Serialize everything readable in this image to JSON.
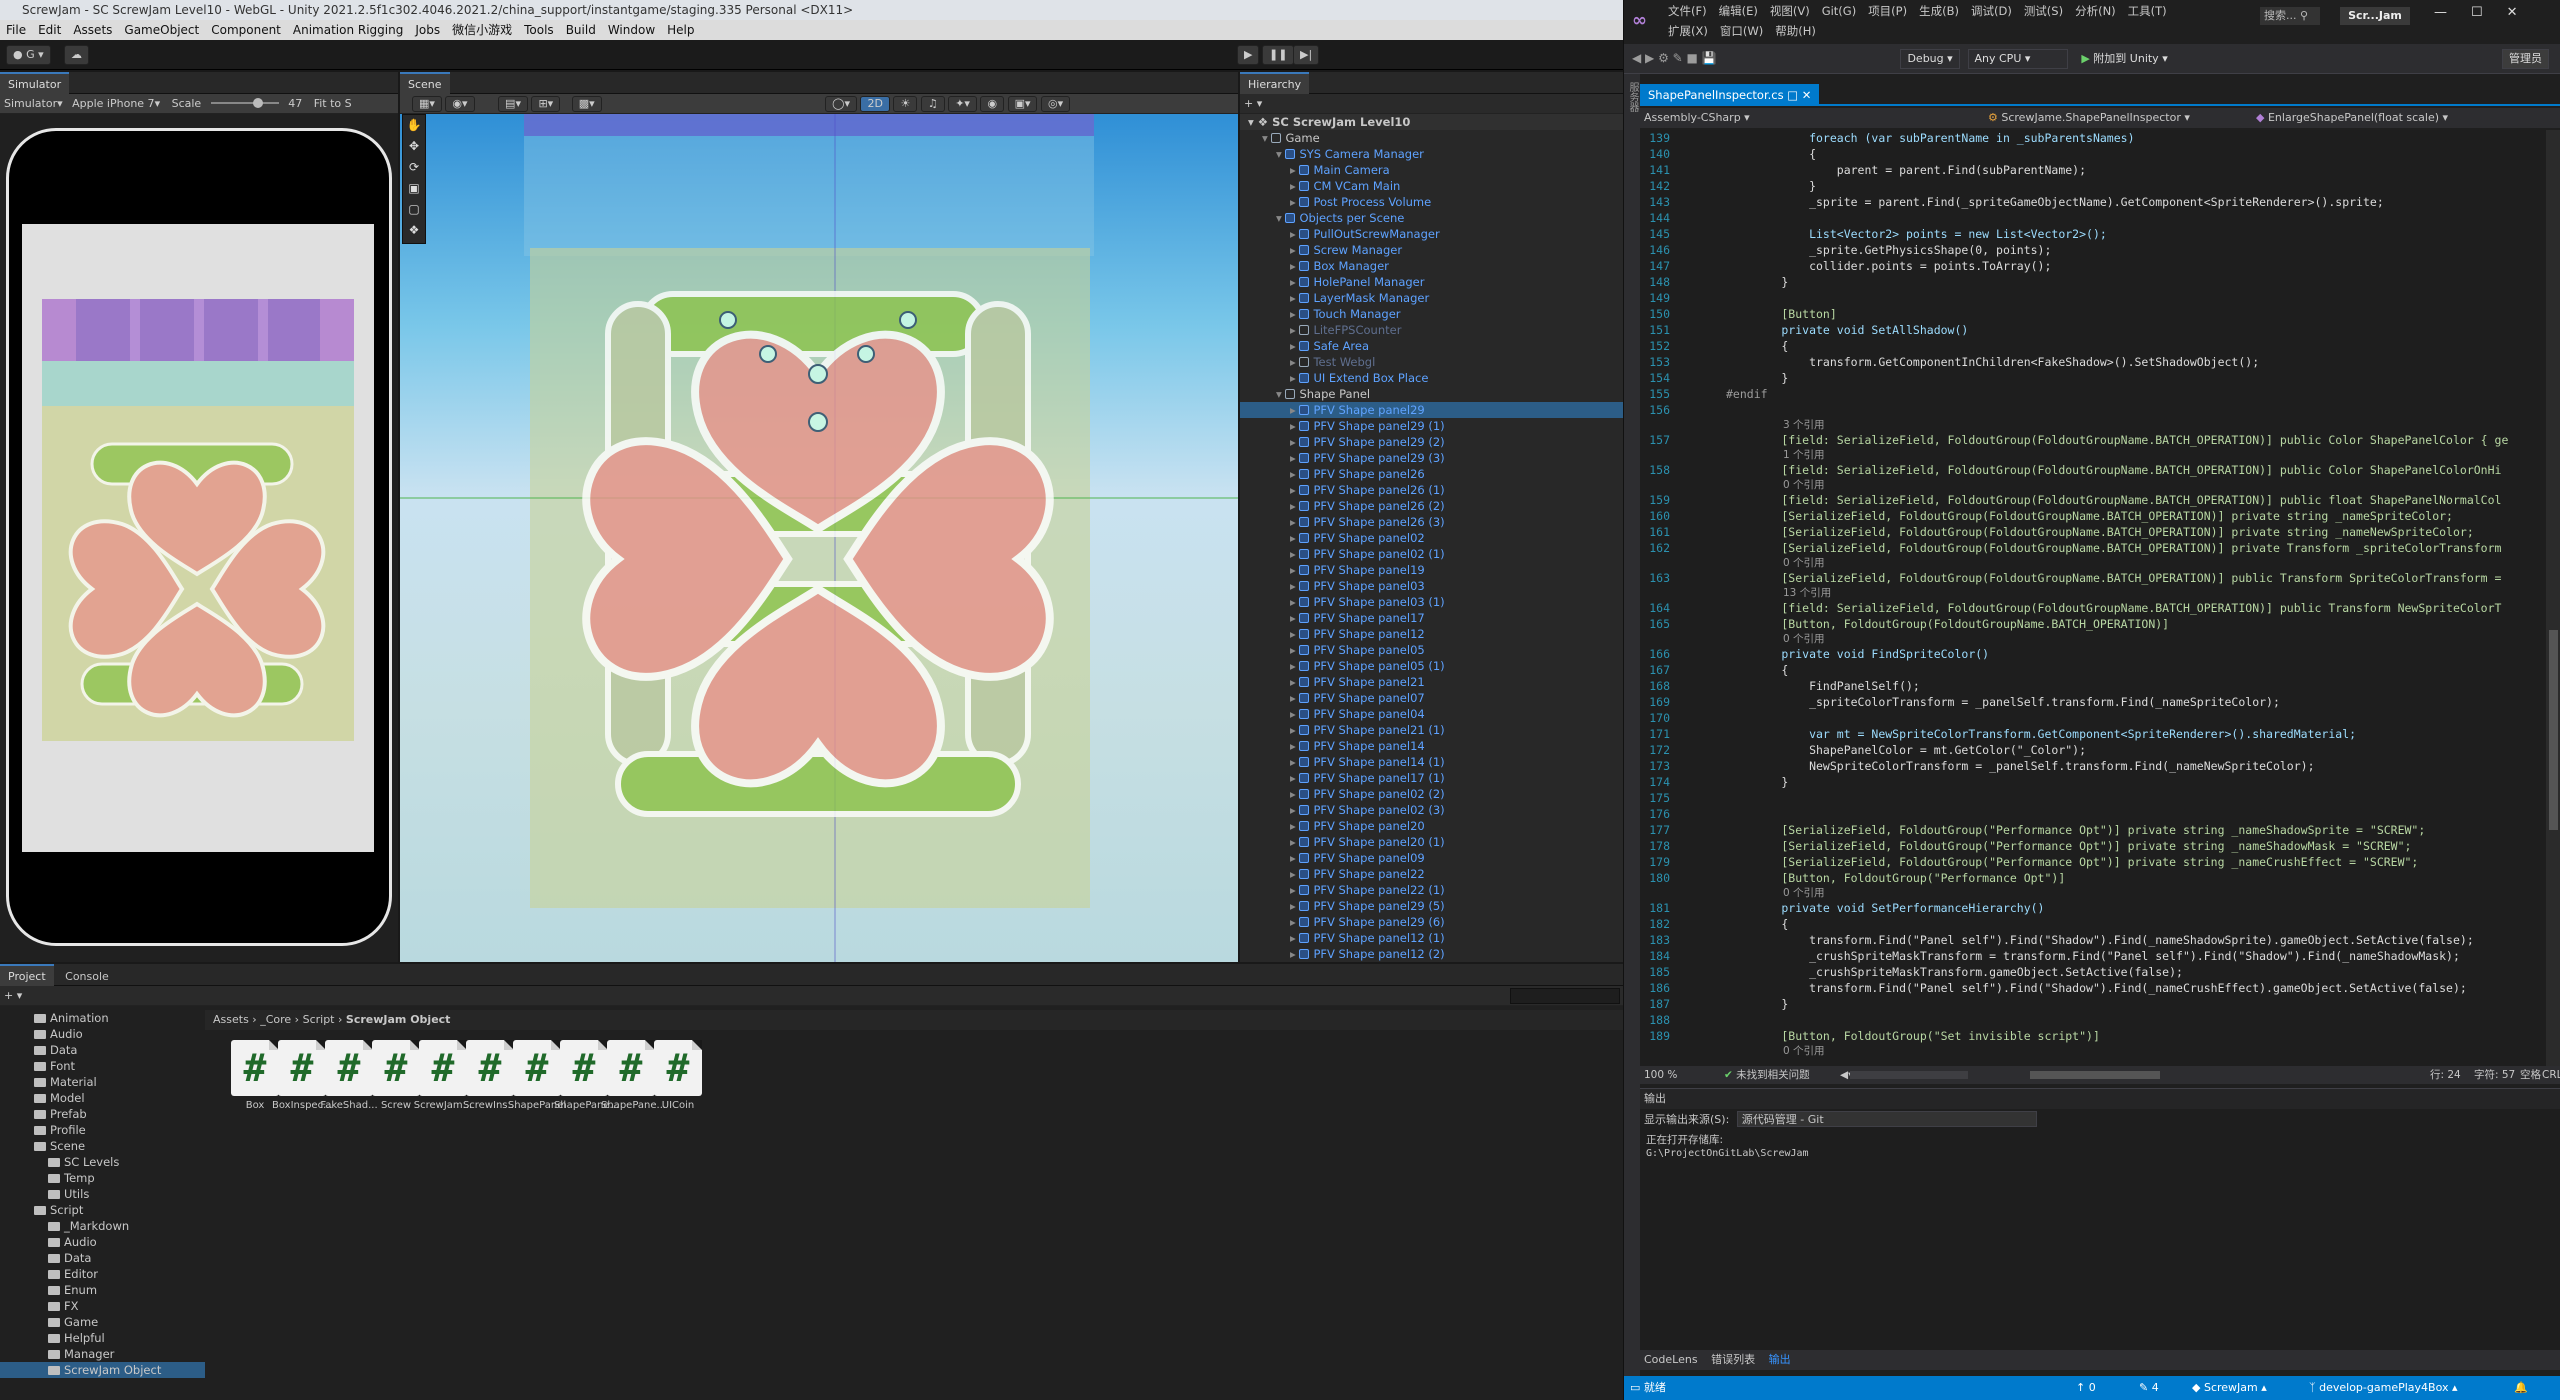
{
  "unity": {
    "title": "ScrewJam - SC ScrewJam Level10 - WebGL - Unity 2021.2.5f1c302.4046.2021.2/china_support/instantgame/staging.335 Personal <DX11>",
    "menu": [
      "File",
      "Edit",
      "Assets",
      "GameObject",
      "Component",
      "Animation Rigging",
      "Jobs",
      "微信小游戏",
      "Tools",
      "Build",
      "Window",
      "Help"
    ],
    "account_label": "G",
    "simulator": {
      "tab": "Simulator",
      "mode": "Simulator",
      "device": "Apple iPhone 7",
      "scale_label": "Scale",
      "scale_value": "47",
      "fit_label": "Fit to S"
    },
    "scene": {
      "tab": "Scene",
      "mode_2d": "2D"
    },
    "hierarchy": {
      "tab": "Hierarchy",
      "root": "SC ScrewJam Level10",
      "rows": [
        {
          "label": "Game",
          "indent": 1,
          "style": ""
        },
        {
          "label": "SYS Camera Manager",
          "indent": 2,
          "style": "blue"
        },
        {
          "label": "Main Camera",
          "indent": 3,
          "style": "blue"
        },
        {
          "label": "CM VCam Main",
          "indent": 3,
          "style": "blue"
        },
        {
          "label": "Post Process Volume",
          "indent": 3,
          "style": "blue"
        },
        {
          "label": "Objects per Scene",
          "indent": 2,
          "style": "blue"
        },
        {
          "label": "PullOutScrewManager",
          "indent": 3,
          "style": "blue"
        },
        {
          "label": "Screw Manager",
          "indent": 3,
          "style": "blue"
        },
        {
          "label": "Box Manager",
          "indent": 3,
          "style": "blue"
        },
        {
          "label": "HolePanel Manager",
          "indent": 3,
          "style": "blue"
        },
        {
          "label": "LayerMask Manager",
          "indent": 3,
          "style": "blue"
        },
        {
          "label": "Touch Manager",
          "indent": 3,
          "style": "blue"
        },
        {
          "label": "LiteFPSCounter",
          "indent": 3,
          "style": "dim"
        },
        {
          "label": "Safe Area",
          "indent": 3,
          "style": "blue"
        },
        {
          "label": "Test Webgl",
          "indent": 3,
          "style": "dim"
        },
        {
          "label": "UI Extend Box Place",
          "indent": 3,
          "style": "blue"
        },
        {
          "label": "Shape Panel",
          "indent": 2,
          "style": ""
        },
        {
          "label": "PFV Shape panel29",
          "indent": 3,
          "style": "blue"
        },
        {
          "label": "PFV Shape panel29 (1)",
          "indent": 3,
          "style": "blue"
        },
        {
          "label": "PFV Shape panel29 (2)",
          "indent": 3,
          "style": "blue"
        },
        {
          "label": "PFV Shape panel29 (3)",
          "indent": 3,
          "style": "blue"
        },
        {
          "label": "PFV Shape panel26",
          "indent": 3,
          "style": "blue"
        },
        {
          "label": "PFV Shape panel26 (1)",
          "indent": 3,
          "style": "blue"
        },
        {
          "label": "PFV Shape panel26 (2)",
          "indent": 3,
          "style": "blue"
        },
        {
          "label": "PFV Shape panel26 (3)",
          "indent": 3,
          "style": "blue"
        },
        {
          "label": "PFV Shape panel02",
          "indent": 3,
          "style": "blue"
        },
        {
          "label": "PFV Shape panel02 (1)",
          "indent": 3,
          "style": "blue"
        },
        {
          "label": "PFV Shape panel19",
          "indent": 3,
          "style": "blue"
        },
        {
          "label": "PFV Shape panel03",
          "indent": 3,
          "style": "blue"
        },
        {
          "label": "PFV Shape panel03 (1)",
          "indent": 3,
          "style": "blue"
        },
        {
          "label": "PFV Shape panel17",
          "indent": 3,
          "style": "blue"
        },
        {
          "label": "PFV Shape panel12",
          "indent": 3,
          "style": "blue"
        },
        {
          "label": "PFV Shape panel05",
          "indent": 3,
          "style": "blue"
        },
        {
          "label": "PFV Shape panel05 (1)",
          "indent": 3,
          "style": "blue"
        },
        {
          "label": "PFV Shape panel21",
          "indent": 3,
          "style": "blue"
        },
        {
          "label": "PFV Shape panel07",
          "indent": 3,
          "style": "blue"
        },
        {
          "label": "PFV Shape panel04",
          "indent": 3,
          "style": "blue"
        },
        {
          "label": "PFV Shape panel21 (1)",
          "indent": 3,
          "style": "blue"
        },
        {
          "label": "PFV Shape panel14",
          "indent": 3,
          "style": "blue"
        },
        {
          "label": "PFV Shape panel14 (1)",
          "indent": 3,
          "style": "blue"
        },
        {
          "label": "PFV Shape panel17 (1)",
          "indent": 3,
          "style": "blue"
        },
        {
          "label": "PFV Shape panel02 (2)",
          "indent": 3,
          "style": "blue"
        },
        {
          "label": "PFV Shape panel02 (3)",
          "indent": 3,
          "style": "blue"
        },
        {
          "label": "PFV Shape panel20",
          "indent": 3,
          "style": "blue"
        },
        {
          "label": "PFV Shape panel20 (1)",
          "indent": 3,
          "style": "blue"
        },
        {
          "label": "PFV Shape panel09",
          "indent": 3,
          "style": "blue"
        },
        {
          "label": "PFV Shape panel22",
          "indent": 3,
          "style": "blue"
        },
        {
          "label": "PFV Shape panel22 (1)",
          "indent": 3,
          "style": "blue"
        },
        {
          "label": "PFV Shape panel29 (5)",
          "indent": 3,
          "style": "blue"
        },
        {
          "label": "PFV Shape panel29 (6)",
          "indent": 3,
          "style": "blue"
        },
        {
          "label": "PFV Shape panel12 (1)",
          "indent": 3,
          "style": "blue"
        },
        {
          "label": "PFV Shape panel12 (2)",
          "indent": 3,
          "style": "blue"
        }
      ]
    },
    "project": {
      "tab_project": "Project",
      "tab_console": "Console",
      "breadcrumb": [
        "Assets",
        "_Core",
        "Script",
        "ScrewJam Object"
      ],
      "tree": [
        {
          "label": "Animation",
          "indent": 1
        },
        {
          "label": "Audio",
          "indent": 1
        },
        {
          "label": "Data",
          "indent": 1
        },
        {
          "label": "Font",
          "indent": 1
        },
        {
          "label": "Material",
          "indent": 1
        },
        {
          "label": "Model",
          "indent": 1
        },
        {
          "label": "Prefab",
          "indent": 1
        },
        {
          "label": "Profile",
          "indent": 1
        },
        {
          "label": "Scene",
          "indent": 1
        },
        {
          "label": "SC Levels",
          "indent": 2
        },
        {
          "label": "Temp",
          "indent": 2
        },
        {
          "label": "Utils",
          "indent": 2
        },
        {
          "label": "Script",
          "indent": 1
        },
        {
          "label": "_Markdown",
          "indent": 2
        },
        {
          "label": "Audio",
          "indent": 2
        },
        {
          "label": "Data",
          "indent": 2
        },
        {
          "label": "Editor",
          "indent": 2
        },
        {
          "label": "Enum",
          "indent": 2
        },
        {
          "label": "FX",
          "indent": 2
        },
        {
          "label": "Game",
          "indent": 2
        },
        {
          "label": "Helpful",
          "indent": 2
        },
        {
          "label": "Manager",
          "indent": 2
        },
        {
          "label": "ScrewJam Object",
          "indent": 2
        }
      ],
      "assets": [
        "Box",
        "BoxInspec...",
        "FakeShad...",
        "Screw",
        "ScrewJam...",
        "ScrewIns...",
        "ShapePanel",
        "ShapePane...",
        "ShapePane...",
        "UICoin"
      ]
    }
  },
  "vs": {
    "menu_row1": [
      "文件(F)",
      "编辑(E)",
      "视图(V)",
      "Git(G)",
      "项目(P)",
      "生成(B)",
      "调试(D)",
      "测试(S)",
      "分析(N)",
      "工具(T)"
    ],
    "menu_row2": [
      "扩展(X)",
      "窗口(W)",
      "帮助(H)"
    ],
    "search_label": "搜索...",
    "solution_name": "Scr...Jam",
    "config": "Debug",
    "platform": "Any CPU",
    "attach": "附加到 Unity",
    "admin_label": "管理员",
    "file_tab": "ShapePanelInspector.cs",
    "nav": {
      "project": "Assembly-CSharp",
      "class": "ScrewJame.ShapePanelInspector",
      "member": "EnlargeShapePanel(float scale)"
    },
    "code": [
      {
        "n": "139",
        "t": "            foreach (var subParentName in _subParentsNames)"
      },
      {
        "n": "140",
        "t": "            {"
      },
      {
        "n": "141",
        "t": "                parent = parent.Find(subParentName);"
      },
      {
        "n": "142",
        "t": "            }"
      },
      {
        "n": "143",
        "t": "            _sprite = parent.Find(_spriteGameObjectName).GetComponent<SpriteRenderer>().sprite;"
      },
      {
        "n": "144",
        "t": ""
      },
      {
        "n": "145",
        "t": "            List<Vector2> points = new List<Vector2>();"
      },
      {
        "n": "146",
        "t": "            _sprite.GetPhysicsShape(0, points);"
      },
      {
        "n": "147",
        "t": "            collider.points = points.ToArray();"
      },
      {
        "n": "148",
        "t": "        }"
      },
      {
        "n": "149",
        "t": ""
      },
      {
        "n": "150",
        "t": "        [Button]"
      },
      {
        "n": "151",
        "t": "        private void SetAllShadow()"
      },
      {
        "n": "152",
        "t": "        {"
      },
      {
        "n": "153",
        "t": "            transform.GetComponentInChildren<FakeShadow>().SetShadowObject();"
      },
      {
        "n": "154",
        "t": "        }"
      },
      {
        "n": "155",
        "t": "#endif"
      },
      {
        "n": "156",
        "t": ""
      },
      {
        "ref": "3 个引用"
      },
      {
        "n": "157",
        "t": "        [field: SerializeField, FoldoutGroup(FoldoutGroupName.BATCH_OPERATION)] public Color ShapePanelColor { ge"
      },
      {
        "ref": "1 个引用"
      },
      {
        "n": "158",
        "t": "        [field: SerializeField, FoldoutGroup(FoldoutGroupName.BATCH_OPERATION)] public Color ShapePanelColorOnHi"
      },
      {
        "ref": "0 个引用"
      },
      {
        "n": "159",
        "t": "        [field: SerializeField, FoldoutGroup(FoldoutGroupName.BATCH_OPERATION)] public float ShapePanelNormalCol"
      },
      {
        "n": "160",
        "t": "        [SerializeField, FoldoutGroup(FoldoutGroupName.BATCH_OPERATION)] private string _nameSpriteColor;"
      },
      {
        "n": "161",
        "t": "        [SerializeField, FoldoutGroup(FoldoutGroupName.BATCH_OPERATION)] private string _nameNewSpriteColor;"
      },
      {
        "n": "162",
        "t": "        [SerializeField, FoldoutGroup(FoldoutGroupName.BATCH_OPERATION)] private Transform _spriteColorTransform"
      },
      {
        "ref": "0 个引用"
      },
      {
        "n": "163",
        "t": "        [SerializeField, FoldoutGroup(FoldoutGroupName.BATCH_OPERATION)] public Transform SpriteColorTransform ="
      },
      {
        "ref": "13 个引用"
      },
      {
        "n": "164",
        "t": "        [field: SerializeField, FoldoutGroup(FoldoutGroupName.BATCH_OPERATION)] public Transform NewSpriteColorT"
      },
      {
        "n": "165",
        "t": "        [Button, FoldoutGroup(FoldoutGroupName.BATCH_OPERATION)]"
      },
      {
        "ref": "0 个引用"
      },
      {
        "n": "166",
        "t": "        private void FindSpriteColor()"
      },
      {
        "n": "167",
        "t": "        {"
      },
      {
        "n": "168",
        "t": "            FindPanelSelf();"
      },
      {
        "n": "169",
        "t": "            _spriteColorTransform = _panelSelf.transform.Find(_nameSpriteColor);"
      },
      {
        "n": "170",
        "t": ""
      },
      {
        "n": "171",
        "t": "            var mt = NewSpriteColorTransform.GetComponent<SpriteRenderer>().sharedMaterial;"
      },
      {
        "n": "172",
        "t": "            ShapePanelColor = mt.GetColor(\"_Color\");"
      },
      {
        "n": "173",
        "t": "            NewSpriteColorTransform = _panelSelf.transform.Find(_nameNewSpriteColor);"
      },
      {
        "n": "174",
        "t": "        }"
      },
      {
        "n": "175",
        "t": ""
      },
      {
        "n": "176",
        "t": ""
      },
      {
        "n": "177",
        "t": "        [SerializeField, FoldoutGroup(\"Performance Opt\")] private string _nameShadowSprite = \"SCREW\";"
      },
      {
        "n": "178",
        "t": "        [SerializeField, FoldoutGroup(\"Performance Opt\")] private string _nameShadowMask = \"SCREW\";"
      },
      {
        "n": "179",
        "t": "        [SerializeField, FoldoutGroup(\"Performance Opt\")] private string _nameCrushEffect = \"SCREW\";"
      },
      {
        "n": "180",
        "t": "        [Button, FoldoutGroup(\"Performance Opt\")]"
      },
      {
        "ref": "0 个引用"
      },
      {
        "n": "181",
        "t": "        private void SetPerformanceHierarchy()"
      },
      {
        "n": "182",
        "t": "        {"
      },
      {
        "n": "183",
        "t": "            transform.Find(\"Panel self\").Find(\"Shadow\").Find(_nameShadowSprite).gameObject.SetActive(false);"
      },
      {
        "n": "184",
        "t": "            _crushSpriteMaskTransform = transform.Find(\"Panel self\").Find(\"Shadow\").Find(_nameShadowMask);"
      },
      {
        "n": "185",
        "t": "            _crushSpriteMaskTransform.gameObject.SetActive(false);"
      },
      {
        "n": "186",
        "t": "            transform.Find(\"Panel self\").Find(\"Shadow\").Find(_nameCrushEffect).gameObject.SetActive(false);"
      },
      {
        "n": "187",
        "t": "        }"
      },
      {
        "n": "188",
        "t": ""
      },
      {
        "n": "189",
        "t": "        [Button, FoldoutGroup(\"Set invisible script\")]"
      },
      {
        "ref": "0 个引用"
      }
    ],
    "status_strip": {
      "zoom": "100 %",
      "issues": "未找到相关问题",
      "row": "行: 24",
      "col": "字符: 57",
      "mode": "空格",
      "eol": "CRLF"
    },
    "output": {
      "title": "输出",
      "source_label": "显示输出来源(S):",
      "source_value": "源代码管理 - Git",
      "lines": [
        "正在打开存储库:",
        "G:\\ProjectOnGitLab\\ScrewJam"
      ]
    },
    "bottom_tabs": [
      "CodeLens",
      "错误列表",
      "输出"
    ],
    "statusbar": {
      "ready": "就绪",
      "up": "0",
      "pencil": "4",
      "repo": "ScrewJam",
      "branch": "develop-gamePlay4Box"
    }
  },
  "colors": {
    "vs_blue": "#007acc",
    "unity_select": "#2c5d87",
    "panel_pink": "#e8928a",
    "panel_green": "#8bc34a"
  }
}
